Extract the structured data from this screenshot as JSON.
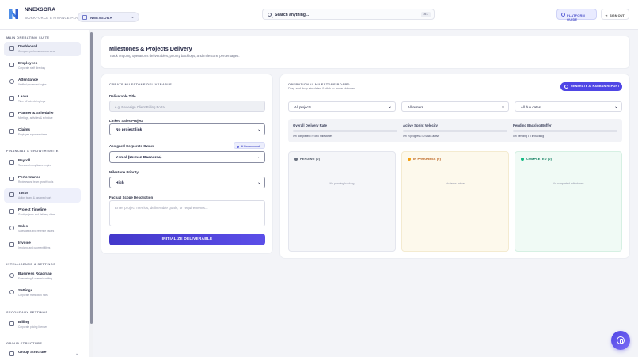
{
  "header": {
    "brand": "NNEXSORA",
    "brand_sub": "WORKFORCE & FINANCE PLATFORM",
    "org_select": "NNEXSORA",
    "search_placeholder": "Search anything...",
    "search_shortcut": "⌘K",
    "guide_label": "PLATFORM GUIDE",
    "signout_label": "SIGN OUT"
  },
  "sidebar": {
    "sections": [
      {
        "title": "MAIN OPERATING SUITE",
        "items": [
          {
            "label": "Dashboard",
            "sub": "Company performance overview",
            "icon": "grid-icon"
          },
          {
            "label": "Employees",
            "sub": "Corporate staff directory",
            "icon": "users-icon"
          },
          {
            "label": "Attendance",
            "sub": "Verified geofenced logins",
            "icon": "clock-icon"
          },
          {
            "label": "Leave",
            "sub": "Time off scheduling logs",
            "icon": "calendar-icon"
          },
          {
            "label": "Planner & Scheduler",
            "sub": "Meetings, activities & schedule",
            "icon": "planner-icon"
          },
          {
            "label": "Claims",
            "sub": "Employee expense claims",
            "icon": "receipt-icon"
          }
        ]
      },
      {
        "title": "FINANCIAL & GROWTH SUITE",
        "items": [
          {
            "label": "Payroll",
            "sub": "Taxes and compliance engine",
            "icon": "payroll-icon"
          },
          {
            "label": "Performance",
            "sub": "Reviews and team growth tools",
            "icon": "chart-icon"
          },
          {
            "label": "Tasks",
            "sub": "Action board & assigned work",
            "icon": "tasks-icon"
          },
          {
            "label": "Project Timeline",
            "sub": "Gantt projects and delivery dates",
            "icon": "timeline-icon"
          },
          {
            "label": "Sales",
            "sub": "Sales deals and revenue values",
            "icon": "sales-icon"
          },
          {
            "label": "Invoice",
            "sub": "Invoicing and payment filters",
            "icon": "invoice-icon"
          }
        ]
      },
      {
        "title": "INTELLIGENCE & SETTINGS",
        "items": [
          {
            "label": "Business Roadmap",
            "sub": "Forecasting & scenario setting",
            "icon": "roadmap-icon"
          },
          {
            "label": "Settings",
            "sub": "Corporate framework rules",
            "icon": "gear-icon"
          }
        ]
      },
      {
        "title": "SECONDARY SETTINGS",
        "items": [
          {
            "label": "Billing",
            "sub": "Corporate pricing licenses",
            "icon": "billing-icon"
          }
        ]
      },
      {
        "title": "GROUP STRUCTURE",
        "items": [
          {
            "label": "Group Structure",
            "sub": "",
            "icon": "structure-icon"
          }
        ]
      }
    ]
  },
  "page": {
    "title": "Milestones & Projects Delivery",
    "subtitle": "Track ongoing operations deliverables, priority backlogs, and milestone percentages."
  },
  "form": {
    "title": "CREATE MILESTONE DELIVERABLE",
    "deliverable_label": "Deliverable Title",
    "deliverable_placeholder": "e.g. Redesign Client Billing Portal",
    "project_label": "Linked Sales Project",
    "project_value": "No project link",
    "owner_label": "Assigned Corporate Owner",
    "recommend_label": "AI Recommend",
    "owner_value": "Kamal (Human Resource)",
    "priority_label": "Milestone Priority",
    "priority_value": "High",
    "scope_label": "Factual Scope Description",
    "scope_placeholder": "Enter project metrics, deliverable goals, or requirements...",
    "submit_label": "INITIALIZE DELIVERABLE"
  },
  "board": {
    "title": "OPERATIONAL MILESTONE BOARD",
    "subtitle": "Drag-and-drop simulated & click-to-move statuses",
    "generate_label": "GENERATE AI KANBAN REPORT",
    "filters": [
      "All projects",
      "All owners",
      "All due dates"
    ],
    "metrics": [
      {
        "label": "Overall Delivery Rate",
        "value": "0% completed • 0 of 0 milestones",
        "fraction": 0
      },
      {
        "label": "Active Sprint Velocity",
        "value": "0% in progress • 0 tasks active",
        "fraction": 0
      },
      {
        "label": "Pending Backlog Buffer",
        "value": "0% pending • 0 in backlog",
        "fraction": 0
      }
    ],
    "columns": [
      {
        "title": "PENDING (0)",
        "empty": "No pending backlog",
        "color": "#6b7280",
        "text_color": "#4b5563"
      },
      {
        "title": "IN PROGRESS (0)",
        "empty": "No tasks active",
        "color": "#f59e0b",
        "text_color": "#b45309"
      },
      {
        "title": "COMPLETED (0)",
        "empty": "No completed milestones",
        "color": "#10b981",
        "text_color": "#047857"
      }
    ]
  }
}
